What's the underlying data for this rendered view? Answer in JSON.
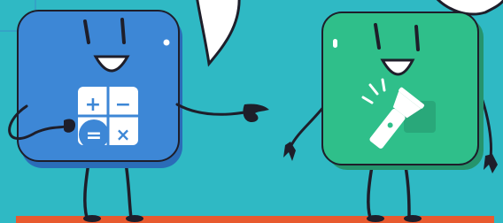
{
  "scene": {
    "background_color": "#2fb9c4",
    "floor_stripe_color": "#e85a2f",
    "left_character": {
      "name": "calculator-app-icon",
      "body_color": "#3d87d6",
      "icon": "calculator-icon",
      "calculator_symbols": [
        "+",
        "−",
        "=",
        "×"
      ]
    },
    "right_character": {
      "name": "flashlight-app-icon",
      "body_color": "#2fbf8a",
      "icon": "flashlight-icon"
    },
    "speech_bubbles": 2
  }
}
